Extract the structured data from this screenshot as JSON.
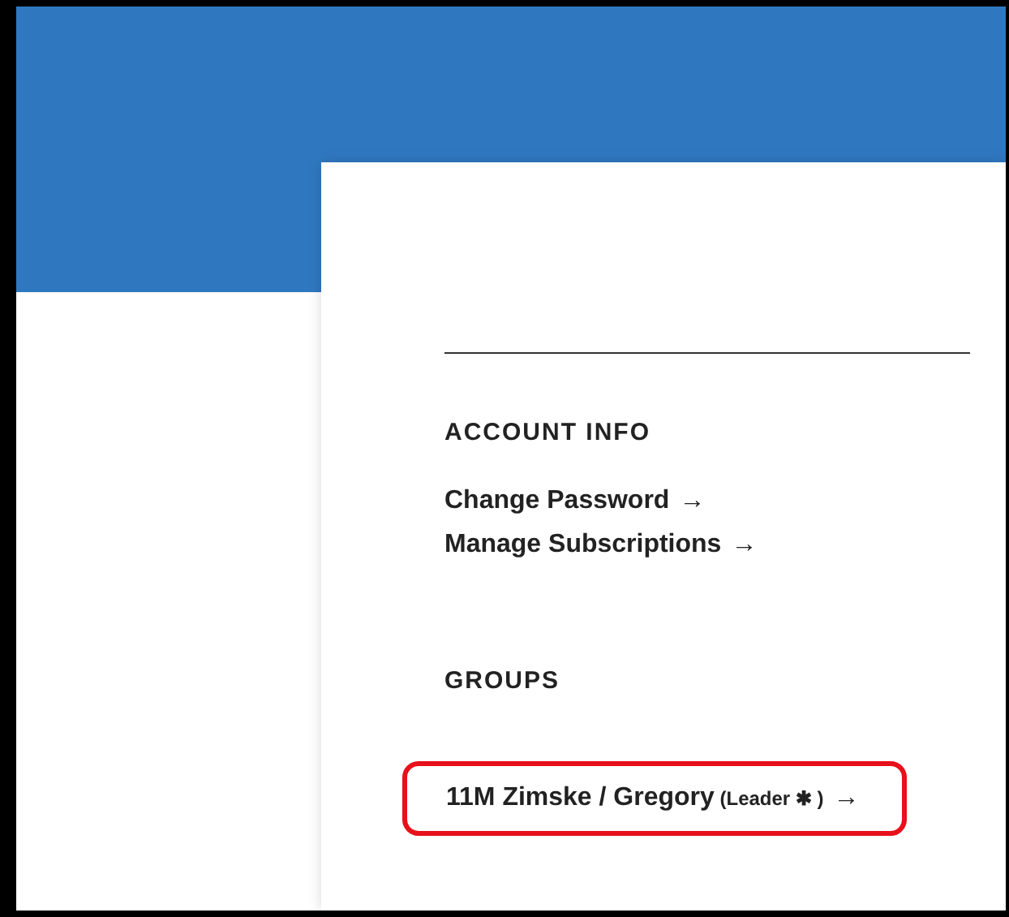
{
  "sections": [
    {
      "heading": "ACCOUNT INFO",
      "links": [
        {
          "label": "Change Password",
          "arrow": "→"
        },
        {
          "label": "Manage Subscriptions",
          "arrow": "→"
        }
      ]
    },
    {
      "heading": "GROUPS",
      "links": [
        {
          "label": "11M Zimske / Gregory",
          "note": "(Leader ✱ )",
          "arrow": "→",
          "highlighted": true
        }
      ]
    }
  ]
}
